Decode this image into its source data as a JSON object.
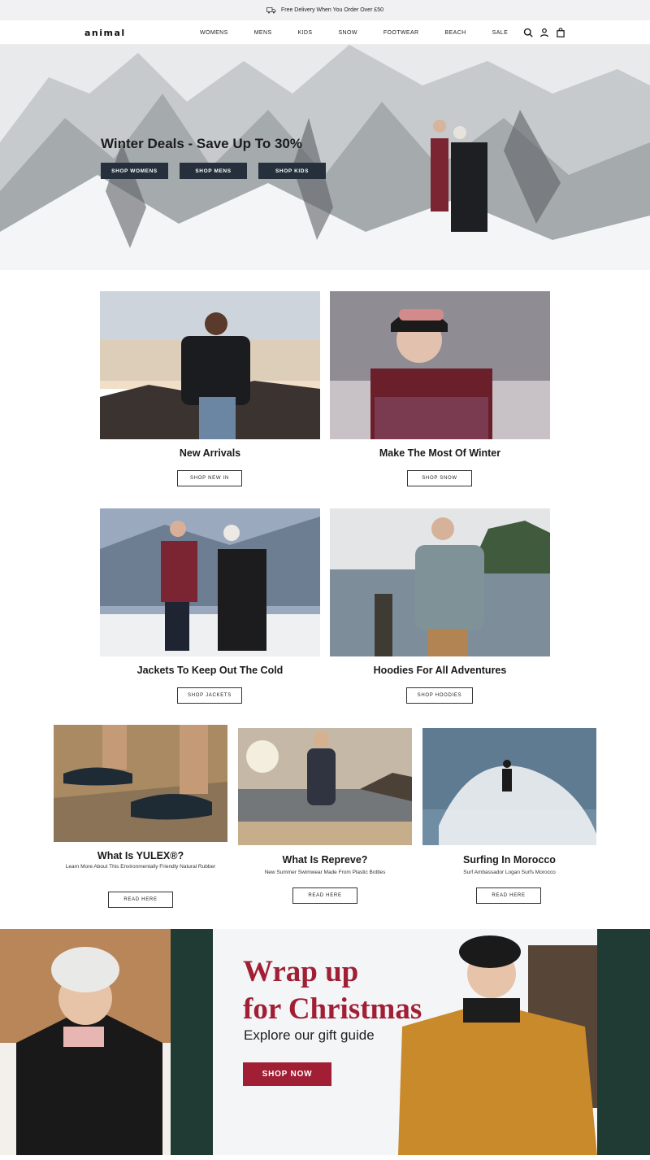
{
  "promo": {
    "text": "Free Delivery When You Order Over £50",
    "icon": "truck-icon"
  },
  "header": {
    "logo": "animal",
    "nav": [
      "WOMENS",
      "MENS",
      "KIDS",
      "SNOW",
      "FOOTWEAR",
      "BEACH",
      "SALE"
    ],
    "icons": [
      "search-icon",
      "account-icon",
      "bag-icon"
    ]
  },
  "hero": {
    "title": "Winter Deals - Save Up To 30%",
    "buttons": [
      "SHOP WOMENS",
      "SHOP MENS",
      "SHOP KIDS"
    ]
  },
  "tiles": [
    {
      "title": "New Arrivals",
      "button": "SHOP NEW IN"
    },
    {
      "title": "Make The Most Of Winter",
      "button": "SHOP SNOW"
    },
    {
      "title": "Jackets To Keep Out The Cold",
      "button": "SHOP JACKETS"
    },
    {
      "title": "Hoodies For All Adventures",
      "button": "SHOP HOODIES"
    }
  ],
  "stories": [
    {
      "title": "What Is YULEX®?",
      "subtitle": "Learn More About This Environmentally Friendly Natural Rubber",
      "button": "READ HERE"
    },
    {
      "title": "What Is Repreve?",
      "subtitle": "New Summer Swimwear Made From Plastic Bottles",
      "button": "READ HERE"
    },
    {
      "title": "Surfing In Morocco",
      "subtitle": "Surf Ambassador Logan Surfs Morocco",
      "button": "READ HERE"
    }
  ],
  "christmas": {
    "title_line1": "Wrap up",
    "title_line2": "for Christmas",
    "subtitle": "Explore our gift guide",
    "button": "SHOP NOW"
  },
  "colors": {
    "accent_red": "#a11f35",
    "dark_button": "#25303c",
    "promo_bg": "#f1f1f3"
  }
}
